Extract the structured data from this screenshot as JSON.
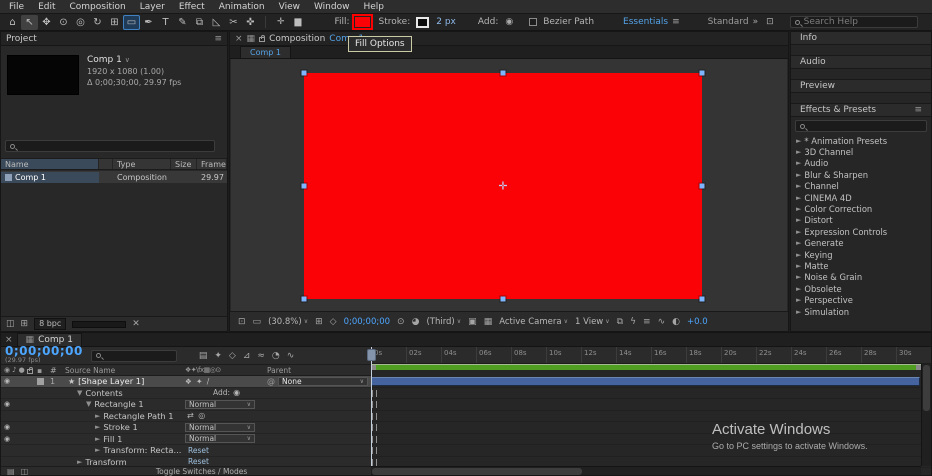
{
  "colors": {
    "fill_red": "#fb0207",
    "accent_blue": "#54a3e8",
    "timecode_blue": "#4da6ff",
    "render_bar_green": "#4f9d21",
    "layer_bar_blue": "#44639f",
    "selection_handle_blue": "#7fb5ff",
    "annotation_red": "#ff0000"
  },
  "icons": {
    "panel_menu": "≡",
    "close": "×",
    "chevron_down": "∨",
    "chevrons": "»",
    "grid_box": "⊡",
    "eye": "◉",
    "audio": "♪",
    "solo": "●",
    "pickwhip": "@",
    "star": "★",
    "add": "◉",
    "label_chip": "▪",
    "panel": "▦",
    "delete": "✕"
  },
  "menu": {
    "items": [
      "File",
      "Edit",
      "Composition",
      "Layer",
      "Effect",
      "Animation",
      "View",
      "Window",
      "Help"
    ]
  },
  "toolbar": {
    "tools": [
      {
        "name": "home-tool",
        "glyph": "⌂"
      },
      {
        "name": "selection-tool",
        "glyph": "↖",
        "state": "active"
      },
      {
        "name": "hand-tool",
        "glyph": "✥"
      },
      {
        "name": "zoom-tool",
        "glyph": "⊙"
      },
      {
        "name": "orbit-camera-tool",
        "glyph": "◎"
      },
      {
        "name": "rotation-tool",
        "glyph": "↻"
      },
      {
        "name": "pan-behind-tool",
        "glyph": "⊞"
      },
      {
        "name": "shape-tool",
        "glyph": "▭",
        "state": "selected"
      },
      {
        "name": "pen-tool",
        "glyph": "✒"
      },
      {
        "name": "type-tool",
        "glyph": "T"
      },
      {
        "name": "brush-tool",
        "glyph": "✎"
      },
      {
        "name": "clone-stamp-tool",
        "glyph": "⧉"
      },
      {
        "name": "eraser-tool",
        "glyph": "◺"
      },
      {
        "name": "roto-brush-tool",
        "glyph": "✂"
      },
      {
        "name": "puppet-pin-tool",
        "glyph": "✜"
      }
    ],
    "shape_option_icons": [
      {
        "name": "anchor-point-grid-icon",
        "glyph": "✛"
      },
      {
        "name": "shape-preview-icon",
        "glyph": "▆"
      }
    ],
    "fill_label": "Fill:",
    "stroke_label": "Stroke:",
    "stroke_width": "2 px",
    "add_label": "Add:",
    "bezier_path_label": "Bezier Path",
    "workspace_active": "Essentials",
    "workspace_secondary": "Standard",
    "search_placeholder": "Search Help",
    "tooltip": "Fill Options"
  },
  "project": {
    "tab": "Project",
    "item_name": "Comp 1",
    "item_dims": "1920 x 1080 (1.00)",
    "item_duration": "Δ 0;00;30;00, 29.97 fps",
    "columns": [
      "Name",
      "Type",
      "Size",
      "Frame ..."
    ],
    "row": {
      "name": "Comp 1",
      "type": "Composition",
      "size": "",
      "frame": "29.97"
    },
    "bit_depth": "8 bpc",
    "bottom_icons": [
      {
        "name": "interpret-footage-icon",
        "glyph": "◫"
      },
      {
        "name": "new-folder-icon",
        "glyph": "⊞"
      }
    ]
  },
  "composition": {
    "tab_title": "Composition",
    "tab_comp": "Comp 1",
    "viewer_tab": "Comp 1",
    "statusbar_items": [
      {
        "name": "always-preview-icon",
        "type": "icon",
        "glyph": "⊡"
      },
      {
        "name": "monitor-icon",
        "type": "icon",
        "glyph": "▭"
      },
      {
        "name": "magnification-dropdown",
        "type": "dropdown",
        "label": "(30.8%)"
      },
      {
        "name": "choose-grid-icon",
        "type": "icon",
        "glyph": "⊞"
      },
      {
        "name": "mask-visibility-icon",
        "type": "icon",
        "glyph": "◇"
      },
      {
        "name": "preview-time",
        "type": "time",
        "label": "0;00;00;00"
      },
      {
        "name": "snapshot-icon",
        "type": "icon",
        "glyph": "⊙"
      },
      {
        "name": "show-channel-icon",
        "type": "icon",
        "glyph": "◕"
      },
      {
        "name": "resolution-dropdown",
        "type": "dropdown",
        "label": "(Third)"
      },
      {
        "name": "region-of-interest-icon",
        "type": "icon",
        "glyph": "▣"
      },
      {
        "name": "transparency-grid-icon",
        "type": "icon",
        "glyph": "▦"
      },
      {
        "name": "camera-dropdown",
        "type": "dropdown",
        "label": "Active Camera"
      },
      {
        "name": "view-layout-dropdown",
        "type": "dropdown",
        "label": "1 View"
      },
      {
        "name": "pixel-aspect-icon",
        "type": "icon",
        "glyph": "⧉"
      },
      {
        "name": "fast-previews-icon",
        "type": "icon",
        "glyph": "ϟ"
      },
      {
        "name": "timeline-button-icon",
        "type": "icon",
        "glyph": "≡"
      },
      {
        "name": "flowchart-button-icon",
        "type": "icon",
        "glyph": "∿"
      },
      {
        "name": "reset-exposure-icon",
        "type": "icon",
        "glyph": "◐"
      },
      {
        "name": "exposure-value",
        "type": "time",
        "label": "+0.0"
      }
    ]
  },
  "right": {
    "panels": [
      {
        "title": "Info"
      },
      {
        "title": "Audio"
      },
      {
        "title": "Preview"
      }
    ],
    "effects": {
      "title": "Effects & Presets",
      "items": [
        "* Animation Presets",
        "3D Channel",
        "Audio",
        "Blur & Sharpen",
        "Channel",
        "CINEMA 4D",
        "Color Correction",
        "Distort",
        "Expression Controls",
        "Generate",
        "Keying",
        "Matte",
        "Noise & Grain",
        "Obsolete",
        "Perspective",
        "Simulation"
      ]
    }
  },
  "timeline": {
    "tab": "Comp 1",
    "timecode": "0;00;00;00",
    "fps_note": "(29.97 fps)",
    "toolbar_icons": [
      {
        "name": "comp-mini-flowchart-icon",
        "glyph": "▤"
      },
      {
        "name": "live-update-icon",
        "glyph": "✦"
      },
      {
        "name": "draft-3d-icon",
        "glyph": "◇"
      },
      {
        "name": "shy-layers-icon",
        "glyph": "⊿"
      },
      {
        "name": "frame-blending-icon",
        "glyph": "≈"
      },
      {
        "name": "motion-blur-icon",
        "glyph": "◔"
      },
      {
        "name": "graph-editor-icon",
        "glyph": "∿"
      }
    ],
    "columns": {
      "number": "#",
      "source": "Source Name",
      "parent": "Parent"
    },
    "switch_icons": "❖✦\\fx▦◎⊙",
    "rows": [
      {
        "kind": "layer",
        "selected": true,
        "eye": true,
        "num": "1",
        "icon": "star",
        "label": "[Shape Layer 1]",
        "switches": "❖ ✦ /",
        "parent_value": "None"
      },
      {
        "kind": "group",
        "indent": 1,
        "twirl": "▼",
        "label": "Contents",
        "add_label": "Add:"
      },
      {
        "kind": "group",
        "indent": 2,
        "twirl": "▼",
        "eye": true,
        "label": "Rectangle 1",
        "mode": "Normal"
      },
      {
        "kind": "prop",
        "indent": 3,
        "twirl": "►",
        "label": "Rectangle Path 1",
        "path_icons": "⇄ ◎"
      },
      {
        "kind": "group",
        "indent": 3,
        "twirl": "►",
        "eye": true,
        "label": "Stroke 1",
        "mode": "Normal"
      },
      {
        "kind": "group",
        "indent": 3,
        "twirl": "►",
        "eye": true,
        "label": "Fill 1",
        "mode": "Normal"
      },
      {
        "kind": "group",
        "indent": 3,
        "twirl": "►",
        "label": "Transform: Recta...",
        "reset_label": "Reset"
      },
      {
        "kind": "group",
        "indent": 1,
        "twirl": "►",
        "label": "Transform",
        "reset_label": "Reset"
      }
    ],
    "ruler": [
      "0s",
      "02s",
      "04s",
      "06s",
      "08s",
      "10s",
      "12s",
      "14s",
      "16s",
      "18s",
      "20s",
      "22s",
      "24s",
      "26s",
      "28s",
      "30s"
    ],
    "toggle_label": "Toggle Switches / Modes",
    "bottom_icons": [
      {
        "name": "expand-layers-icon",
        "glyph": "▤"
      },
      {
        "name": "transfer-controls-icon",
        "glyph": "◫"
      }
    ]
  },
  "watermark": {
    "line1": "Activate Windows",
    "line2": "Go to PC settings to activate Windows."
  }
}
